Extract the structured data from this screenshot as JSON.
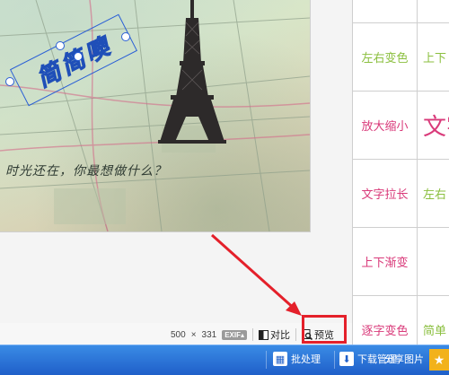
{
  "photo": {
    "caption": "时光还在，你最想做什么？",
    "text_sticker": "简简噢"
  },
  "info_bar": {
    "width": "500",
    "times": "×",
    "height": "331",
    "exif_label": "EXIF",
    "compare_label": "对比",
    "preview_label": "预览"
  },
  "effects": [
    {
      "label": "",
      "color": "#8bbf3f"
    },
    {
      "label": "",
      "color": "#8bbf3f"
    },
    {
      "label": "左右变色",
      "color": "#8bbf3f"
    },
    {
      "label": "上下",
      "color": "#8bbf3f"
    },
    {
      "label": "放大缩小",
      "color": "#d93a7a"
    },
    {
      "label": "文字",
      "color": "#d93a7a",
      "big": true
    },
    {
      "label": "文字拉长",
      "color": "#d93a7a"
    },
    {
      "label": "左右",
      "color": "#8bbf3f"
    },
    {
      "label": "上下渐变",
      "color": "#d93a7a"
    },
    {
      "label": "",
      "color": "#d93a7a"
    },
    {
      "label": "逐字变色",
      "color": "#d93a7a"
    },
    {
      "label": "简单",
      "color": "#8bbf3f"
    }
  ],
  "taskbar": {
    "batch_label": "批处理",
    "manage_label": "下载管理",
    "share_label": "分享图片"
  },
  "colors": {
    "accent_blue": "#2a5fd6",
    "highlight_red": "#e4202a",
    "taskbar_blue": "#1f5fc9"
  }
}
